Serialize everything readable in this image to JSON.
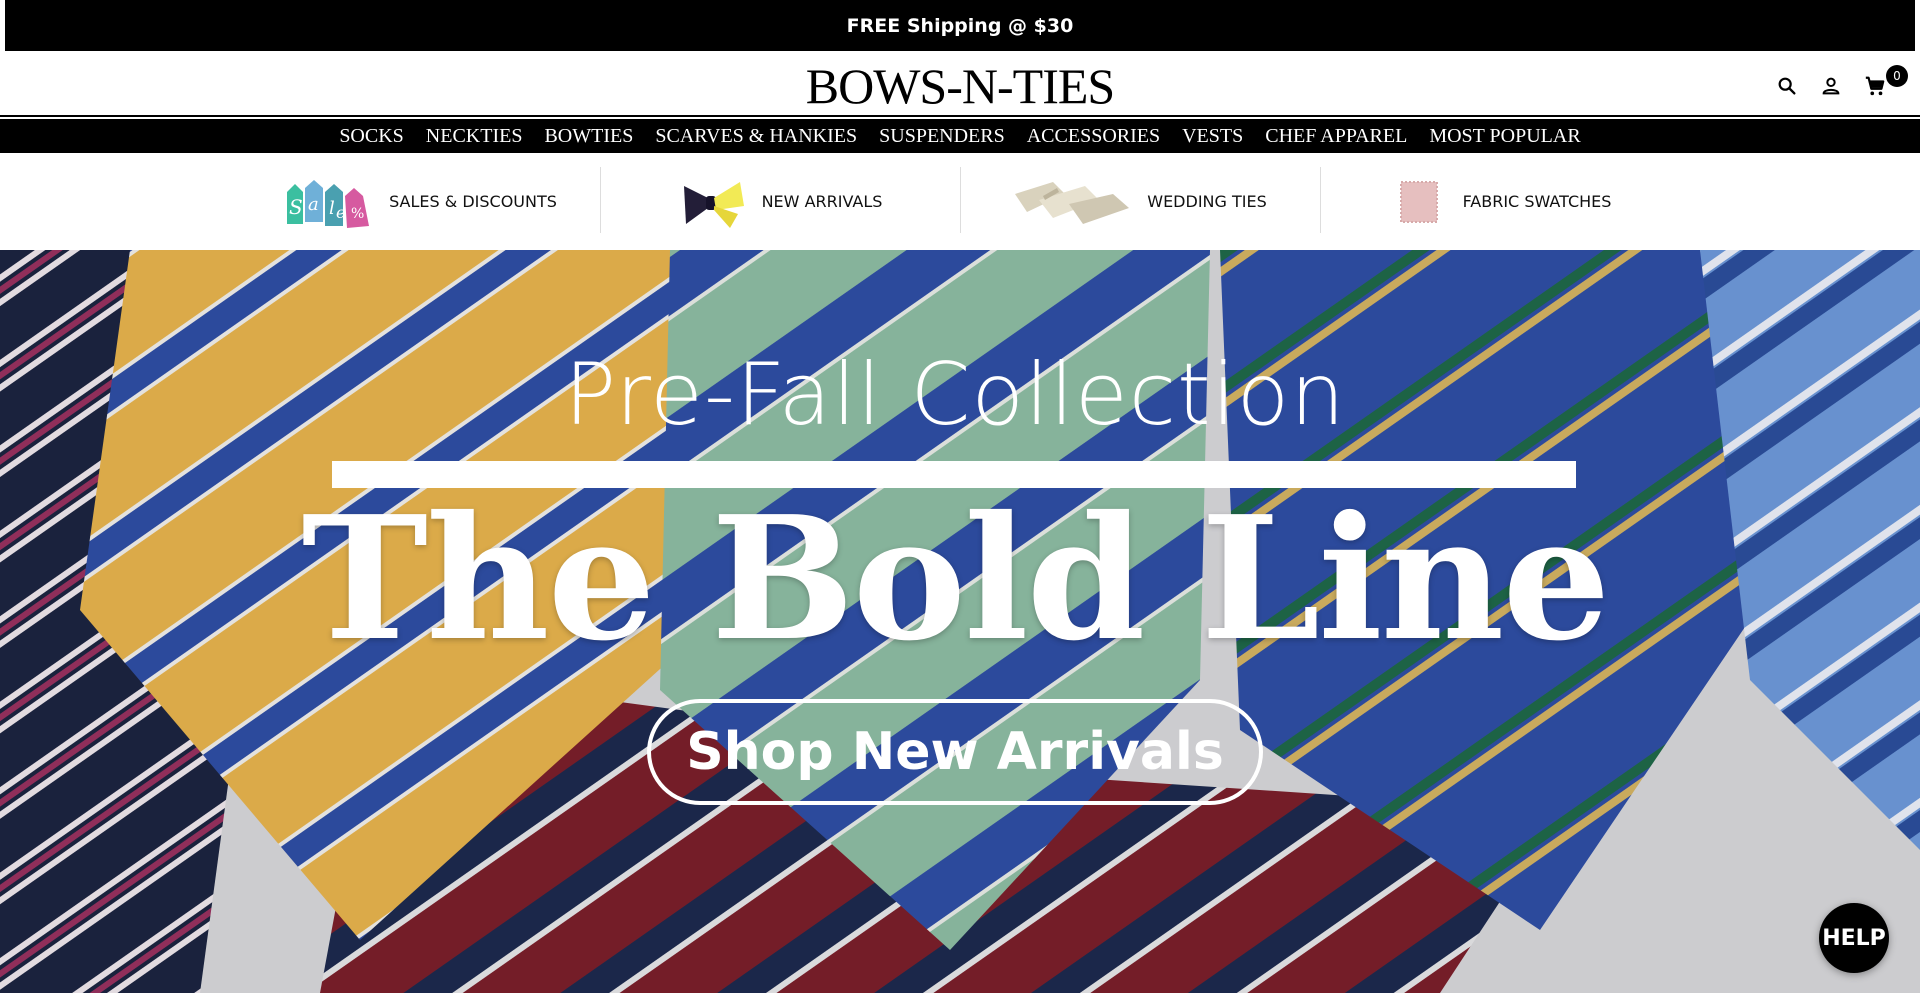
{
  "announcement": {
    "text": "FREE Shipping @ $30"
  },
  "header": {
    "logo": "BOWS-N-TIES",
    "icons": [
      "search-icon",
      "account-icon",
      "cart-icon"
    ],
    "cart_count": "0"
  },
  "nav": {
    "items": [
      "SOCKS",
      "NECKTIES",
      "BOWTIES",
      "SCARVES & HANKIES",
      "SUSPENDERS",
      "ACCESSORIES",
      "VESTS",
      "CHEF APPAREL",
      "MOST POPULAR"
    ]
  },
  "categories": {
    "items": [
      {
        "label": "SALES & DISCOUNTS",
        "icon": "sale-tags-icon",
        "tag_text": "Sale%"
      },
      {
        "label": "NEW ARRIVALS",
        "icon": "bowtie-icon"
      },
      {
        "label": "WEDDING TIES",
        "icon": "wedding-ties-icon"
      },
      {
        "label": "FABRIC SWATCHES",
        "icon": "fabric-swatch-icon"
      }
    ]
  },
  "hero": {
    "subtitle": "Pre-Fall Collection",
    "title": "The Bold Line",
    "cta": "Shop New Arrivals"
  },
  "help": {
    "label": "HELP"
  },
  "colors": {
    "black": "#000000",
    "white": "#ffffff",
    "tie_gold": "#e9b54e",
    "tie_green": "#8fbfa5",
    "tie_blue": "#2f4fa6",
    "tie_navy": "#1c2541",
    "tie_red": "#7c1f2b",
    "tie_sky": "#6f9bdc"
  }
}
